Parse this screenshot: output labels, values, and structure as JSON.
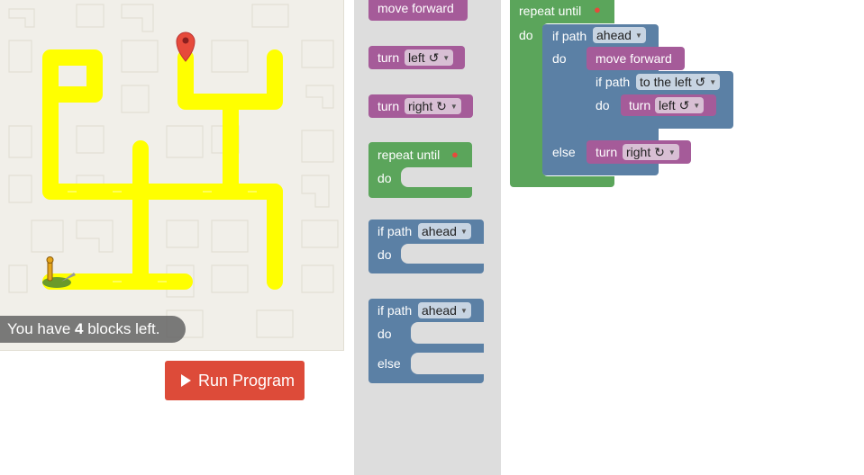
{
  "maze": {
    "blocks_left_prefix": "You have ",
    "blocks_left_count": "4",
    "blocks_left_suffix": " blocks left."
  },
  "run_button": {
    "label": "Run Program"
  },
  "toolbox": {
    "move_forward": "move forward",
    "turn_left_kw": "turn",
    "turn_left_dd": "left ↺",
    "turn_right_kw": "turn",
    "turn_right_dd": "right ↻",
    "repeat_label": "repeat until",
    "repeat_do": "do",
    "if_kw": "if path",
    "if_dd": "ahead",
    "if_do": "do",
    "ifelse_kw": "if path",
    "ifelse_dd": "ahead",
    "ifelse_do": "do",
    "ifelse_else": "else"
  },
  "workspace": {
    "repeat_label": "repeat until",
    "repeat_do": "do",
    "if_kw": "if path",
    "if_dd": "ahead",
    "if_do": "do",
    "move_forward": "move forward",
    "inner_if_kw": "if path",
    "inner_if_dd": "to the left ↺",
    "inner_do": "do",
    "inner_turn_kw": "turn",
    "inner_turn_dd": "left ↺",
    "else": "else",
    "else_turn_kw": "turn",
    "else_turn_dd": "right ↻"
  },
  "colors": {
    "path": "#ffff00",
    "logic_blue": "#5b80a5",
    "loop_green": "#5ba55b",
    "action_purple": "#a55b99",
    "run_red": "#dd4b39"
  }
}
